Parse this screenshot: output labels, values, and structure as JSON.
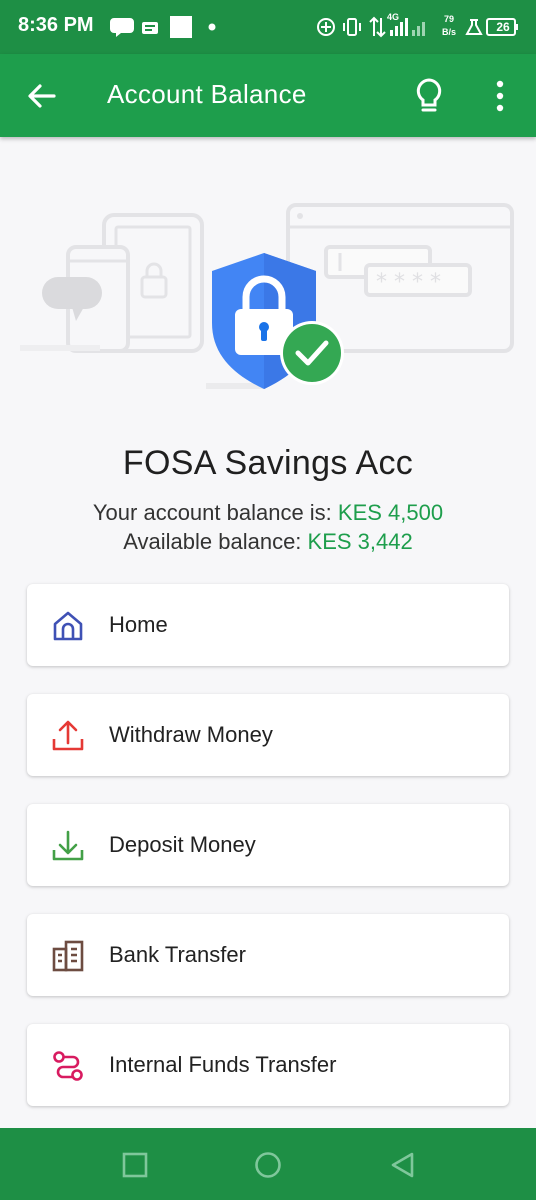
{
  "status_bar": {
    "time": "8:36 PM",
    "network_speed_value": "79",
    "network_speed_unit": "B/s",
    "network_type": "4G",
    "battery": "26"
  },
  "app_bar": {
    "title": "Account Balance"
  },
  "account": {
    "name": "FOSA Savings Acc",
    "balance_label": "Your account balance is:",
    "balance_value": "KES 4,500",
    "available_label": "Available balance:",
    "available_value": "KES 3,442"
  },
  "menu": [
    {
      "label": "Home",
      "icon": "home-icon",
      "color": "#3f51b5"
    },
    {
      "label": "Withdraw Money",
      "icon": "upload-icon",
      "color": "#e53935"
    },
    {
      "label": "Deposit Money",
      "icon": "download-icon",
      "color": "#43a047"
    },
    {
      "label": "Bank Transfer",
      "icon": "bank-icon",
      "color": "#6d4c41"
    },
    {
      "label": "Internal Funds Transfer",
      "icon": "transfer-route-icon",
      "color": "#d81b60"
    }
  ],
  "colors": {
    "primary": "#1e9e4c",
    "status_bar": "#1e8f45",
    "amount": "#1e9e4c",
    "shield": "#4285f4",
    "check_badge": "#34a853"
  }
}
